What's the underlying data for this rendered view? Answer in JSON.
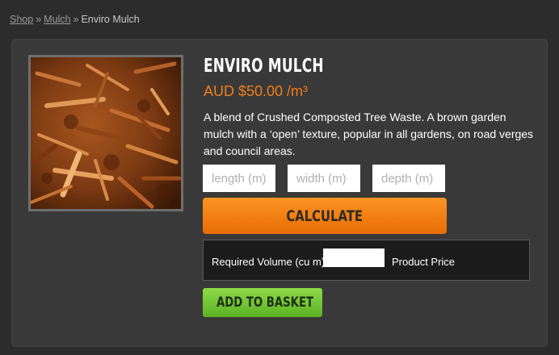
{
  "breadcrumb": {
    "shop": "Shop",
    "separator": "»",
    "mulch": "Mulch",
    "current": "Enviro Mulch"
  },
  "product": {
    "title": "ENVIRO MULCH",
    "price": "AUD $50.00 /m³",
    "description": "A blend of Crushed Composted Tree Waste. A brown garden mulch with a ‘open’ texture, popular in all gardens, on road verges and council areas.",
    "image_icon": "mulch-photo"
  },
  "calculator": {
    "length_placeholder": "length (m)",
    "width_placeholder": "width (m)",
    "depth_placeholder": "depth (m)",
    "length_value": "",
    "width_value": "",
    "depth_value": "",
    "calculate_label": "CALCULATE",
    "volume_label": "Required Volume (cu m)",
    "volume_value": "",
    "product_price_label": "Product Price"
  },
  "actions": {
    "add_to_basket_label": "ADD TO BASKET"
  },
  "colors": {
    "background": "#2c2c2c",
    "panel": "#393939",
    "price_accent": "#f07e1b",
    "calculate_button": "#f37f12",
    "basket_button": "#73c535"
  }
}
